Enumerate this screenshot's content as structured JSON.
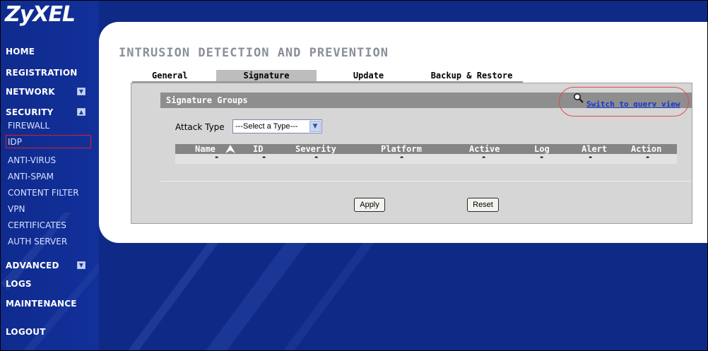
{
  "brand": {
    "logo": "ZyXEL"
  },
  "nav": {
    "home": "HOME",
    "registration": "REGISTRATION",
    "network": "NETWORK",
    "security": "SECURITY",
    "security_items": [
      "FIREWALL",
      "IDP",
      "ANTI-VIRUS",
      "ANTI-SPAM",
      "CONTENT FILTER",
      "VPN",
      "CERTIFICATES",
      "AUTH SERVER"
    ],
    "advanced": "ADVANCED",
    "logs": "LOGS",
    "maintenance": "MAINTENANCE",
    "logout": "LOGOUT",
    "selected": "IDP"
  },
  "page": {
    "title": "INTRUSION DETECTION AND PREVENTION"
  },
  "tabs": [
    "General",
    "Signature",
    "Update",
    "Backup & Restore"
  ],
  "active_tab": "Signature",
  "section": {
    "title": "Signature Groups",
    "query_link": "Switch to query view"
  },
  "filter": {
    "label": "Attack Type",
    "value": "---Select a Type---"
  },
  "table": {
    "columns": [
      "Name",
      "ID",
      "Severity",
      "Platform",
      "Active",
      "Log",
      "Alert",
      "Action"
    ],
    "row": [
      "-",
      "-",
      "-",
      "-",
      "-",
      "-",
      "-",
      "-"
    ]
  },
  "buttons": {
    "apply": "Apply",
    "reset": "Reset"
  },
  "colors": {
    "nav_bg": "#0f2a86",
    "highlight": "#e41b24",
    "link": "#1836c9"
  }
}
